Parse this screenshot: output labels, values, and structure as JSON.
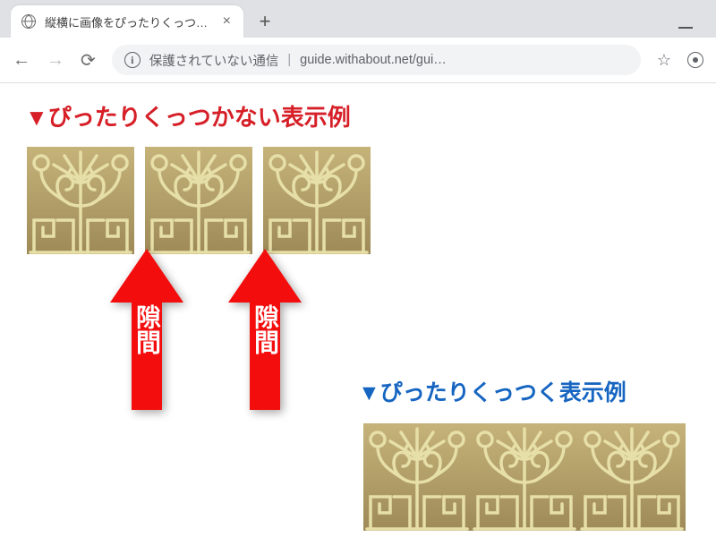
{
  "window": {
    "tab_title": "縦横に画像をぴったりくっつけるサンプ"
  },
  "toolbar": {
    "security_text": "保護されていない通信",
    "url_text": "guide.withabout.net/gui…"
  },
  "page": {
    "heading_bad": "▼ぴったりくっつかない表示例",
    "heading_good": "▼ぴったりくっつく表示例",
    "arrow_label": "隙間"
  }
}
